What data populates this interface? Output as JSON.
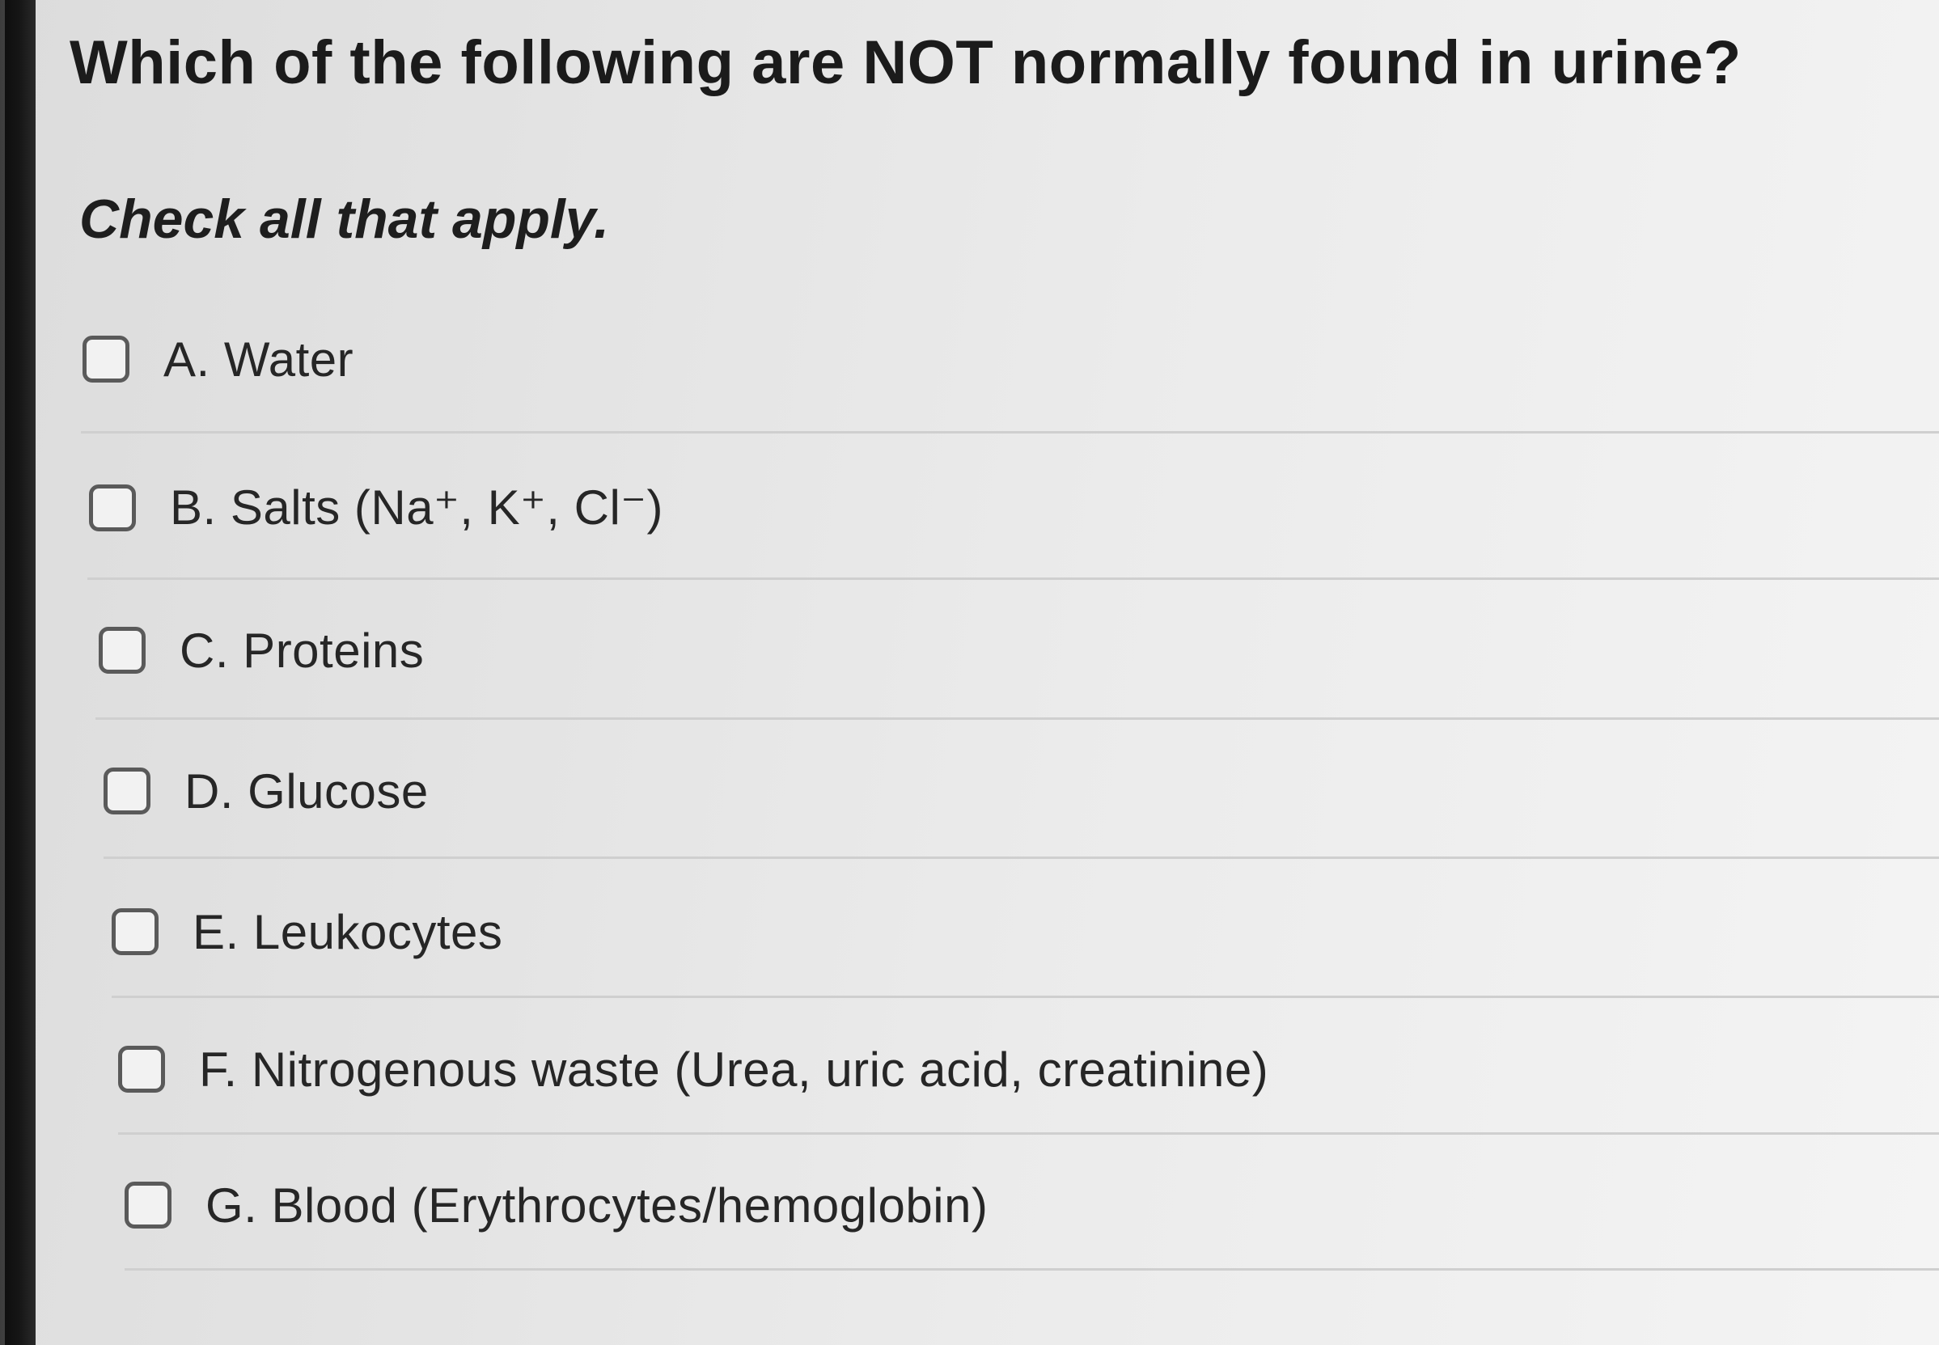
{
  "question": {
    "text": "Which of the following are NOT normally found in urine?",
    "instruction": "Check all that apply."
  },
  "options": [
    {
      "label": "A. Water",
      "checked": false
    },
    {
      "label": "B. Salts (Na⁺, K⁺, Cl⁻)",
      "checked": false
    },
    {
      "label": "C. Proteins",
      "checked": false
    },
    {
      "label": "D. Glucose",
      "checked": false
    },
    {
      "label": "E. Leukocytes",
      "checked": false
    },
    {
      "label": "F. Nitrogenous waste (Urea, uric acid, creatinine)",
      "checked": false
    },
    {
      "label": "G. Blood (Erythrocytes/hemoglobin)",
      "checked": false
    }
  ]
}
